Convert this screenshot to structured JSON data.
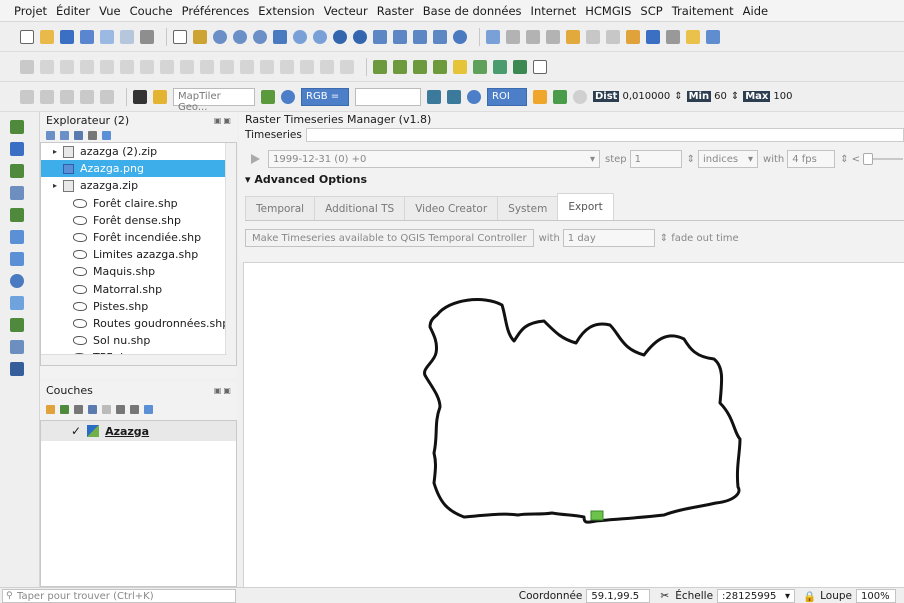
{
  "menu": [
    "Projet",
    "Éditer",
    "Vue",
    "Couche",
    "Préférences",
    "Extension",
    "Vecteur",
    "Raster",
    "Base de données",
    "Internet",
    "HCMGIS",
    "SCP",
    "Traitement",
    "Aide"
  ],
  "toolbar3": {
    "maptiler_placeholder": "MapTiler Geo...",
    "rgb_label": "RGB =",
    "roi_label": "ROI",
    "dist_label": "Dist",
    "dist_value": "0,010000",
    "min_label": "Min",
    "min_value": "60",
    "max_label": "Max",
    "max_value": "100"
  },
  "explorer": {
    "title": "Explorateur (2)",
    "items": [
      {
        "label": "azazga (2).zip",
        "kind": "zip"
      },
      {
        "label": "Azazga.png",
        "kind": "png",
        "selected": true
      },
      {
        "label": "azazga.zip",
        "kind": "zip"
      },
      {
        "label": "Forêt claire.shp",
        "kind": "shp"
      },
      {
        "label": "Forêt dense.shp",
        "kind": "shp"
      },
      {
        "label": "Forêt incendiée.shp",
        "kind": "shp"
      },
      {
        "label": "Limites azazga.shp",
        "kind": "shp"
      },
      {
        "label": "Maquis.shp",
        "kind": "shp"
      },
      {
        "label": "Matorral.shp",
        "kind": "shp"
      },
      {
        "label": "Pistes.shp",
        "kind": "shp"
      },
      {
        "label": "Routes goudronnées.shp",
        "kind": "shp"
      },
      {
        "label": "Sol nu.shp",
        "kind": "shp"
      },
      {
        "label": "TPF.shp",
        "kind": "shp"
      }
    ]
  },
  "couches": {
    "title": "Couches",
    "layers": [
      {
        "label": "Azazga",
        "checked": "✓"
      }
    ]
  },
  "rts": {
    "title": "Raster Timeseries Manager (v1.8)",
    "timeseries_label": "Timeseries",
    "date_value": "1999-12-31 (0) +0",
    "step_label": "step",
    "step_value": "1",
    "indices_value": "indices",
    "with_label": "with",
    "fps_value": "4 fps",
    "advanced": "Advanced Options",
    "tabs": [
      "Temporal",
      "Additional TS",
      "Video Creator",
      "System",
      "Export"
    ],
    "active_tab": "Export",
    "export_button": "Make Timeseries available to QGIS Temporal Controller",
    "export_with": "with",
    "export_duration": "1 day",
    "fade_label": "fade out time"
  },
  "status": {
    "search_placeholder": "Taper pour trouver (Ctrl+K)",
    "coord_label": "Coordonnée",
    "coord_value": "59.1,99.5",
    "scale_label": "Échelle",
    "scale_value": ":28125995",
    "magnifier_label": "Loupe",
    "magnifier_value": "100%"
  },
  "colors": {
    "selection": "#3daee9",
    "outline": "#111111",
    "marker": "#6cc24a"
  }
}
